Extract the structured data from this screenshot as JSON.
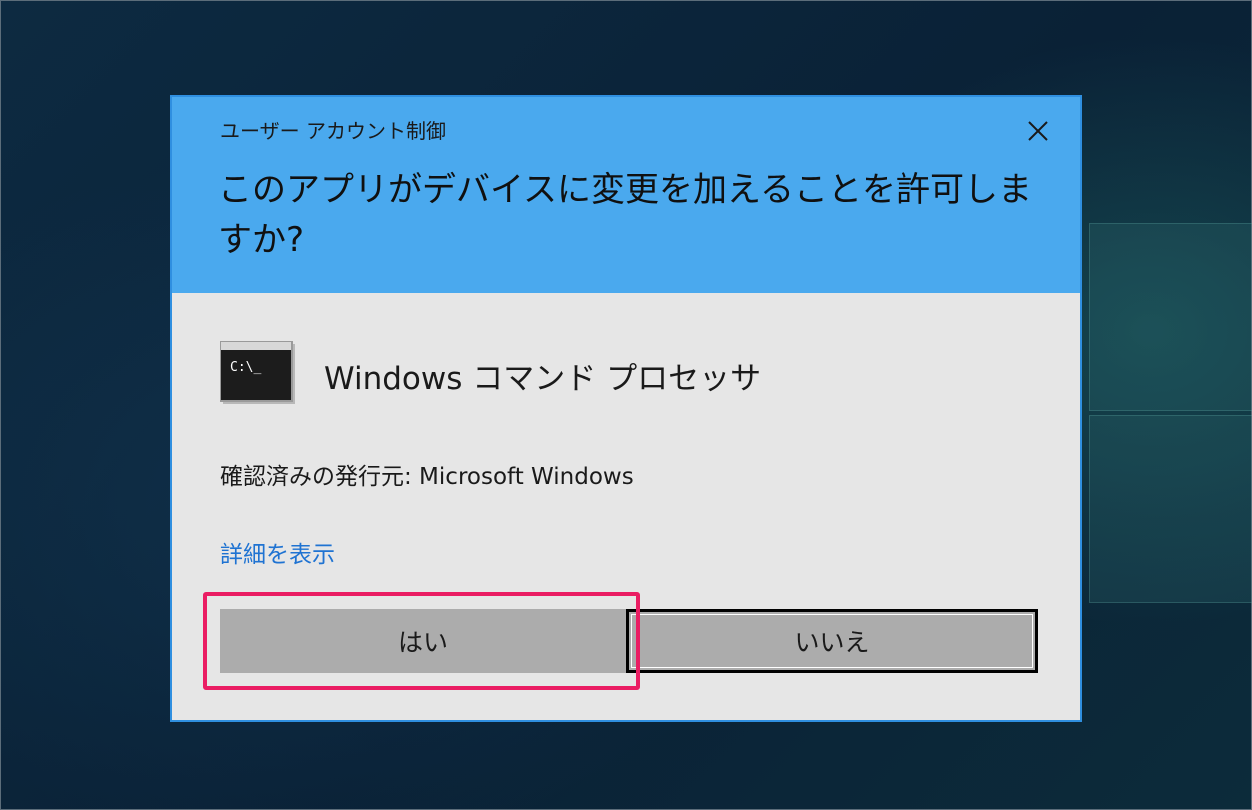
{
  "dialog": {
    "window_title": "ユーザー アカウント制御",
    "question": "このアプリがデバイスに変更を加えることを許可しますか?",
    "app_icon": "command-prompt-icon",
    "app_icon_text": "C:\\_",
    "app_name": "Windows コマンド プロセッサ",
    "publisher": "確認済みの発行元: Microsoft Windows",
    "details_link": "詳細を表示",
    "yes_label": "はい",
    "no_label": "いいえ"
  },
  "colors": {
    "header": "#4aa9ee",
    "body": "#e6e6e6",
    "button": "#acacac",
    "link": "#1f73d2",
    "highlight": "#ea1d63",
    "desktop": "#0b2438"
  }
}
